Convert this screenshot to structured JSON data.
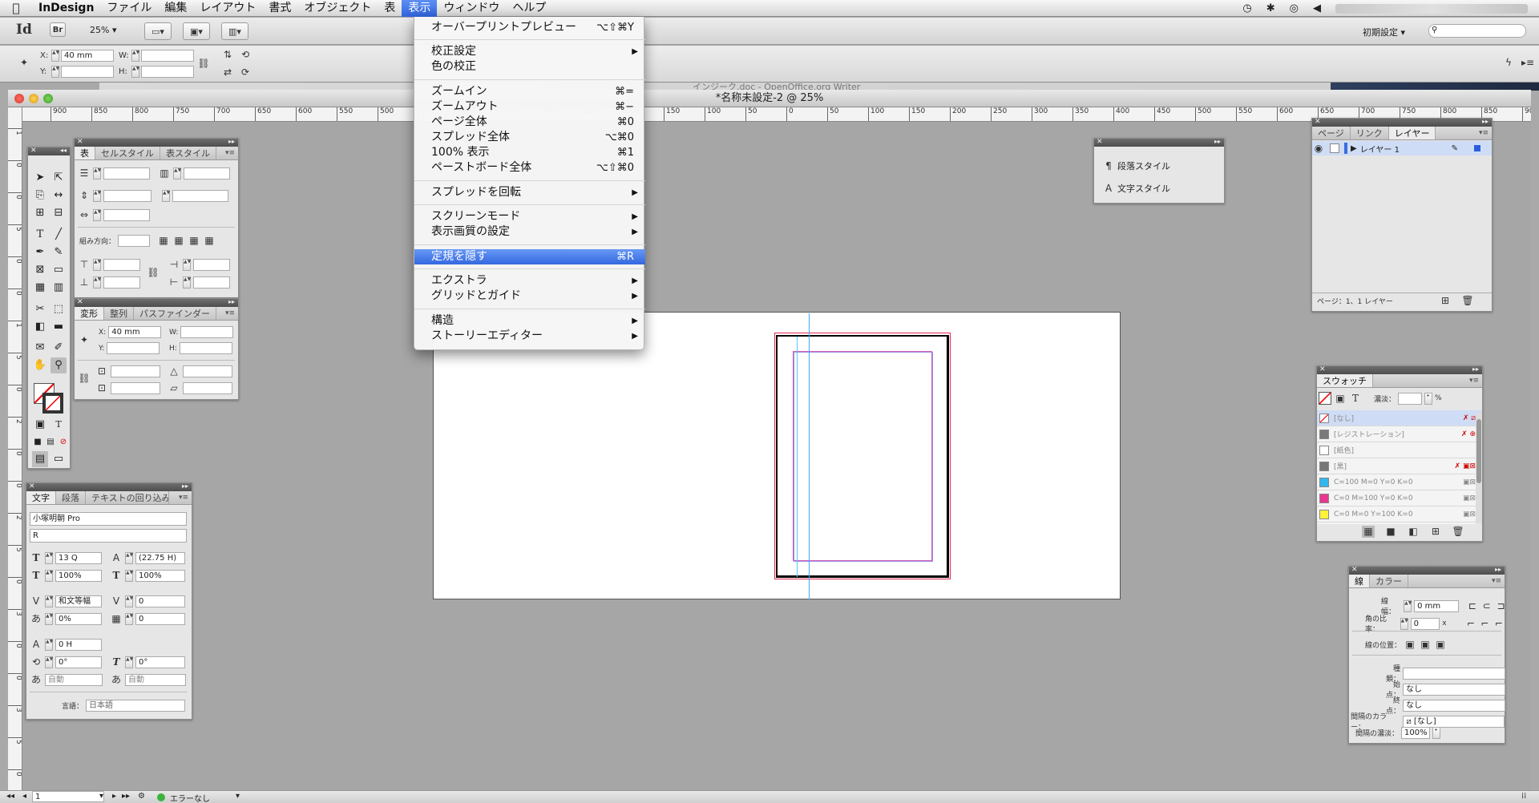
{
  "menubar": {
    "app_name": "InDesign",
    "items": [
      "ファイル",
      "編集",
      "レイアウト",
      "書式",
      "オブジェクト",
      "表",
      "表示",
      "ウィンドウ",
      "ヘルプ"
    ],
    "active": "表示"
  },
  "appbar": {
    "logo": "Id",
    "bridge": "Br",
    "zoom": "25%",
    "workspace": "初期設定"
  },
  "control": {
    "x_label": "X:",
    "x_value": "40 mm",
    "y_label": "Y:",
    "w_label": "W:",
    "h_label": "H:"
  },
  "background_window_title": "インジーク.doc - OpenOffice.org Writer",
  "document": {
    "title": "*名称未設定-2 @ 25%",
    "ruler_labels": [
      "900",
      "850",
      "800",
      "750",
      "700",
      "650",
      "600",
      "550",
      "500",
      "450",
      "400",
      "350",
      "300",
      "250",
      "200",
      "150",
      "100",
      "50",
      "0",
      "50",
      "100",
      "150",
      "200",
      "250",
      "300",
      "350",
      "400",
      "450",
      "500",
      "550",
      "600",
      "650",
      "700",
      "750",
      "800",
      "850",
      "900"
    ],
    "vruler_labels": [
      "1",
      "0",
      "0",
      "5",
      "0",
      "0",
      "1",
      "5",
      "0",
      "2",
      "0",
      "0",
      "2",
      "5",
      "0",
      "3",
      "0",
      "0",
      "3",
      "5",
      "0"
    ]
  },
  "view_menu": {
    "items": [
      {
        "label": "オーバープリントプレビュー",
        "shortcut": "⌥⇧⌘Y"
      },
      {
        "label": "校正設定",
        "submenu": true
      },
      {
        "label": "色の校正"
      },
      {
        "label": "ズームイン",
        "shortcut": "⌘="
      },
      {
        "label": "ズームアウト",
        "shortcut": "⌘−"
      },
      {
        "label": "ページ全体",
        "shortcut": "⌘0"
      },
      {
        "label": "スプレッド全体",
        "shortcut": "⌥⌘0"
      },
      {
        "label": "100% 表示",
        "shortcut": "⌘1"
      },
      {
        "label": "ペーストボード全体",
        "shortcut": "⌥⇧⌘0"
      },
      {
        "label": "スプレッドを回転",
        "submenu": true
      },
      {
        "label": "スクリーンモード",
        "submenu": true
      },
      {
        "label": "表示画質の設定",
        "submenu": true
      },
      {
        "label": "定規を隠す",
        "shortcut": "⌘R",
        "highlighted": true
      },
      {
        "label": "エクストラ",
        "submenu": true
      },
      {
        "label": "グリッドとガイド",
        "submenu": true
      },
      {
        "label": "構造",
        "submenu": true
      },
      {
        "label": "ストーリーエディター",
        "submenu": true
      }
    ]
  },
  "table_panel": {
    "tabs": [
      "表",
      "セルスタイル",
      "表スタイル"
    ],
    "text_direction_label": "組み方向："
  },
  "transform_panel": {
    "tabs": [
      "変形",
      "整列",
      "パスファインダー"
    ],
    "x_label": "X:",
    "x_value": "40 mm",
    "y_label": "Y:",
    "w_label": "W:",
    "h_label": "H:"
  },
  "character_panel": {
    "tabs": [
      "文字",
      "段落",
      "テキストの回り込み"
    ],
    "font_family": "小塚明朝 Pro",
    "font_style": "R",
    "size": "13 Q",
    "leading": "(22.75 H)",
    "vertical_scale": "100%",
    "horizontal_scale": "100%",
    "kerning": "和文等幅",
    "tracking": "0",
    "tsume": "0%",
    "grid_count": "0",
    "baseline": "0 H",
    "rotation": "0°",
    "skew": "0°",
    "auto1": "自動",
    "auto2": "自動",
    "language_label": "言語：",
    "language": "日本語"
  },
  "styles_panel": {
    "items": [
      "段落スタイル",
      "文字スタイル"
    ]
  },
  "layers_panel": {
    "tabs": [
      "ページ",
      "リンク",
      "レイヤー"
    ],
    "layer_name": "レイヤー 1",
    "footer": "ページ：1、1 レイヤー"
  },
  "swatches_panel": {
    "title": "スウォッチ",
    "tint_label": "濃淡：",
    "percent": "%",
    "swatches": [
      {
        "name": "[なし]",
        "color": "#ffffff"
      },
      {
        "name": "[レジストレーション]",
        "color": "#222222"
      },
      {
        "name": "[紙色]",
        "color": "#ffffff"
      },
      {
        "name": "[黒]",
        "color": "#1a1a1a"
      },
      {
        "name": "C=100 M=0 Y=0 K=0",
        "color": "#34b6ee"
      },
      {
        "name": "C=0 M=100 Y=0 K=0",
        "color": "#e8388f"
      },
      {
        "name": "C=0 M=0 Y=100 K=0",
        "color": "#fff23a"
      }
    ]
  },
  "stroke_panel": {
    "tabs": [
      "線",
      "カラー"
    ],
    "weight_label": "線幅：",
    "weight": "0 mm",
    "miter_label": "角の比率：",
    "miter": "0",
    "miter_unit": "x",
    "align_label": "線の位置：",
    "type_label": "種類：",
    "start_label": "始点：",
    "start": "なし",
    "end_label": "終点：",
    "end": "なし",
    "gap_color_label": "間隔のカラー：",
    "gap_color": "[なし]",
    "gap_tint_label": "間隔の濃淡：",
    "gap_tint": "100%"
  },
  "statusbar": {
    "page": "1",
    "errors": "エラーなし"
  }
}
